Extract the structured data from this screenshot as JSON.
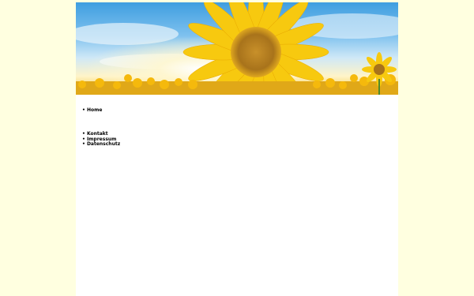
{
  "banner": {
    "image_alt": "sunflower-field-banner"
  },
  "nav_primary": [
    {
      "label": "Home"
    }
  ],
  "nav_secondary": [
    {
      "label": "Kontakt"
    },
    {
      "label": "Impressum"
    },
    {
      "label": "Datenschutz"
    }
  ],
  "colors": {
    "page_background": "#ffffe0",
    "content_background": "#ffffff",
    "sunflower_petal": "#f7c90f",
    "sunflower_center": "#b8860b",
    "sky": "#5fb0ea"
  }
}
